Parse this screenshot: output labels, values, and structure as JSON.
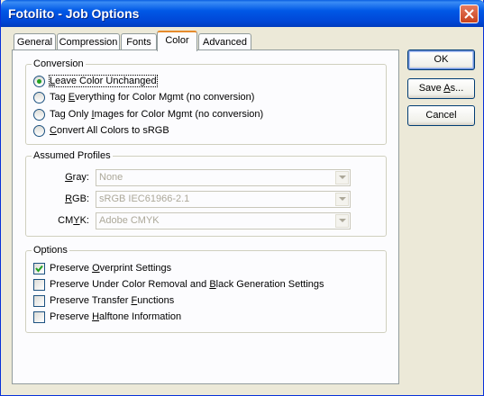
{
  "window": {
    "title": "Fotolito - Job Options"
  },
  "tabs": [
    {
      "label": "General"
    },
    {
      "label": "Compression"
    },
    {
      "label": "Fonts"
    },
    {
      "label": "Color"
    },
    {
      "label": "Advanced"
    }
  ],
  "conversion": {
    "legend": "Conversion",
    "options": [
      {
        "pre": "",
        "key": "L",
        "post": "eave Color Unchanged",
        "selected": true
      },
      {
        "pre": "Tag ",
        "key": "E",
        "post": "verything for Color Mgmt (no conversion)",
        "selected": false
      },
      {
        "pre": "Tag Only ",
        "key": "I",
        "post": "mages for Color Mgmt (no conversion)",
        "selected": false
      },
      {
        "pre": "",
        "key": "C",
        "post": "onvert All Colors to sRGB",
        "selected": false
      }
    ]
  },
  "profiles": {
    "legend": "Assumed Profiles",
    "gray": {
      "label_key": "G",
      "label_rest": "ray:",
      "value": "None"
    },
    "rgb": {
      "label_key": "R",
      "label_rest": "GB:",
      "value": "sRGB IEC61966-2.1"
    },
    "cmyk": {
      "label_pre": "CM",
      "label_key": "Y",
      "label_rest": "K:",
      "value": "Adobe CMYK"
    }
  },
  "options": {
    "legend": "Options",
    "items": [
      {
        "pre": "Preserve ",
        "key": "O",
        "post": "verprint Settings",
        "checked": true
      },
      {
        "pre": "Preserve Under Color Removal and ",
        "key": "B",
        "post": "lack Generation Settings",
        "checked": false
      },
      {
        "pre": "Preserve Transfer ",
        "key": "F",
        "post": "unctions",
        "checked": false
      },
      {
        "pre": "Preserve ",
        "key": "H",
        "post": "alftone Information",
        "checked": false
      }
    ]
  },
  "buttons": {
    "ok": "OK",
    "save_pre": "Save ",
    "save_key": "A",
    "save_post": "s...",
    "cancel": "Cancel"
  },
  "colors": {
    "title_bar": "#0058e6",
    "close": "#c8411d",
    "dialog_bg": "#ece9d8",
    "active_tab_accent": "#e68b2c"
  }
}
